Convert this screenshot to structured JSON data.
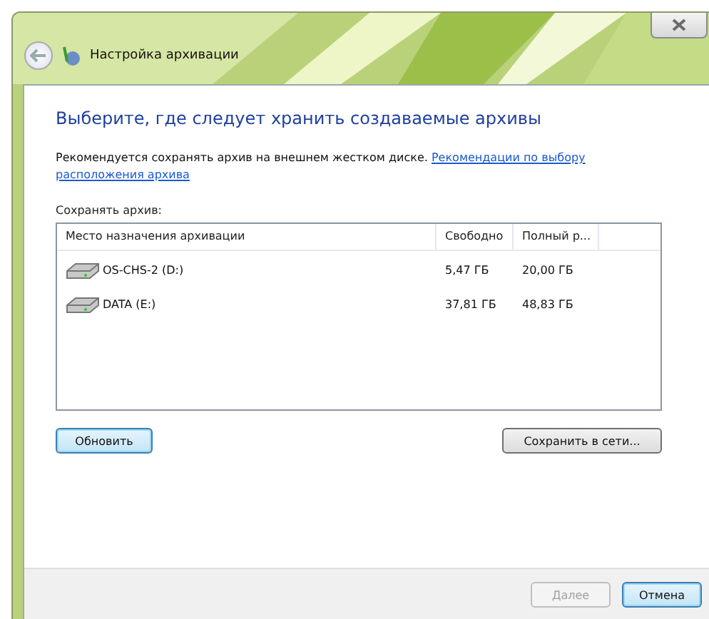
{
  "window": {
    "title": "Настройка архивации"
  },
  "heading": "Выберите, где следует хранить создаваемые архивы",
  "description": "Рекомендуется сохранять архив на внешнем жестком диске.",
  "link_lines": [
    "Рекомендации по выбору",
    "расположения архива"
  ],
  "list_label": "Сохранять архив:",
  "table": {
    "columns": [
      "Место назначения архивации",
      "Свободно",
      "Полный р..."
    ],
    "rows": [
      {
        "name": "OS-CHS-2 (D:)",
        "free": "5,47 ГБ",
        "total": "20,00 ГБ"
      },
      {
        "name": "DATA (E:)",
        "free": "37,81 ГБ",
        "total": "48,83 ГБ"
      }
    ]
  },
  "refresh_button": {
    "label": "Обновить",
    "focused": true
  },
  "network_button": {
    "label": "Сохранить в сети...",
    "focused": false
  },
  "footer_buttons": [
    {
      "label": "Далее",
      "disabled": true,
      "focused": false
    },
    {
      "label": "Отмена",
      "disabled": false,
      "focused": true
    }
  ]
}
